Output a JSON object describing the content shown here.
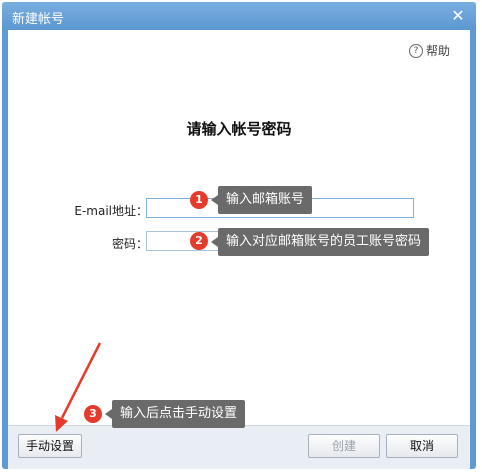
{
  "window": {
    "title": "新建帐号",
    "close_symbol": "✕"
  },
  "help": {
    "label": "帮助",
    "icon": "question-circle-icon",
    "icon_glyph": "?"
  },
  "form": {
    "heading": "请输入帐号密码",
    "email_label": "E-mail地址：",
    "email_value": "",
    "password_label": "密码：",
    "password_value": ""
  },
  "annotations": [
    {
      "number": "1",
      "text": "输入邮箱账号"
    },
    {
      "number": "2",
      "text": "输入对应邮箱账号的员工账号密码"
    },
    {
      "number": "3",
      "text": "输入后点击手动设置"
    }
  ],
  "footer": {
    "manual_setup": "手动设置",
    "create": "创建",
    "cancel": "取消"
  },
  "colors": {
    "accent": "#5e9ad4",
    "badge": "#e43b2c",
    "callout": "#6a6a6a",
    "arrow": "#e43b2c"
  }
}
